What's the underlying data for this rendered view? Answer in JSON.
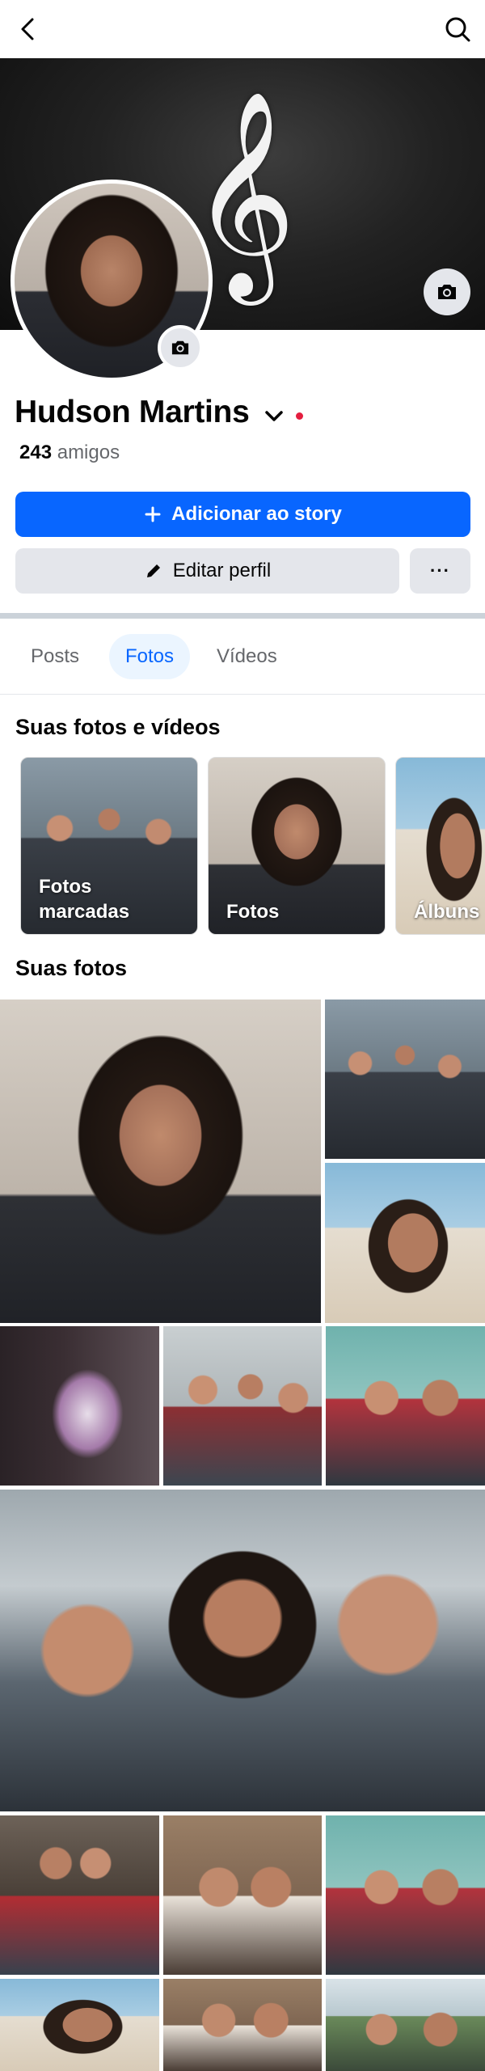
{
  "header": {
    "back_icon": "back-arrow-icon",
    "search_icon": "search-icon"
  },
  "profile": {
    "name": "Hudson Martins",
    "friends_count": "243",
    "friends_label": "amigos",
    "online_dot_color": "#e41e3f"
  },
  "actions": {
    "add_story_label": "Adicionar ao story",
    "edit_profile_label": "Editar perfil",
    "more_label": "···"
  },
  "colors": {
    "accent": "#0866ff",
    "button_gray": "#e4e6eb"
  },
  "tabs": [
    {
      "label": "Posts",
      "active": false
    },
    {
      "label": "Fotos",
      "active": true
    },
    {
      "label": "Vídeos",
      "active": false
    }
  ],
  "sections": {
    "your_photos_videos": "Suas fotos e vídeos",
    "your_photos": "Suas fotos"
  },
  "albums": [
    {
      "label_line1": "Fotos",
      "label_line2": "marcadas"
    },
    {
      "label_line1": "Fotos",
      "label_line2": ""
    },
    {
      "label_line1": "Álbuns",
      "label_line2": ""
    }
  ]
}
